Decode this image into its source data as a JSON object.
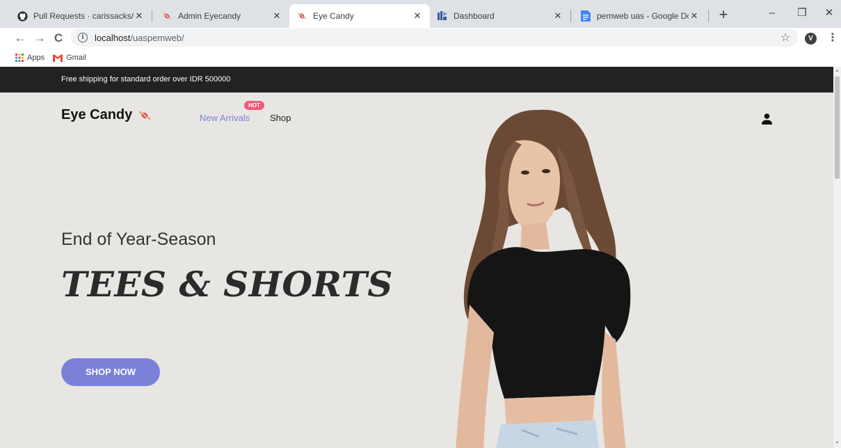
{
  "browser": {
    "tabs": [
      {
        "title": "Pull Requests · carissacks/uasp",
        "favicon": "github-icon",
        "active": false
      },
      {
        "title": "Admin Eyecandy",
        "favicon": "candy-icon",
        "active": false
      },
      {
        "title": "Eye Candy",
        "favicon": "candy-icon",
        "active": true
      },
      {
        "title": "Dashboard",
        "favicon": "dashboard-icon",
        "active": false
      },
      {
        "title": "pemweb uas - Google Docs",
        "favicon": "docs-icon",
        "active": false
      }
    ],
    "new_tab": "+",
    "window_controls": {
      "minimize": "–",
      "restore": "❐",
      "close": "✕"
    },
    "nav": {
      "back": "←",
      "forward": "→",
      "reload": "C"
    },
    "address": {
      "host": "localhost",
      "path": "/uaspemweb/"
    },
    "profile_initial": "V",
    "bookmarks": [
      {
        "label": "Apps",
        "icon": "apps-grid-icon"
      },
      {
        "label": "Gmail",
        "icon": "gmail-icon"
      }
    ],
    "accent_colors": {
      "tab_strip": "#dee1e6",
      "omnibox": "#f1f3f4"
    }
  },
  "site": {
    "promo_text": "Free shipping for standard order over IDR 500000",
    "logo_text": "Eye Candy",
    "nav": [
      {
        "label": "New Arrivals",
        "badge": "HOT"
      },
      {
        "label": "Shop"
      }
    ],
    "hero": {
      "subtitle": "End of Year-Season",
      "headline": "TEES & SHORTS",
      "cta": "SHOP NOW"
    },
    "colors": {
      "accent": "#7b81d9",
      "badge": "#f25a7a",
      "promo_bar": "#222222",
      "hero_bg": "#e8e6e3"
    }
  }
}
